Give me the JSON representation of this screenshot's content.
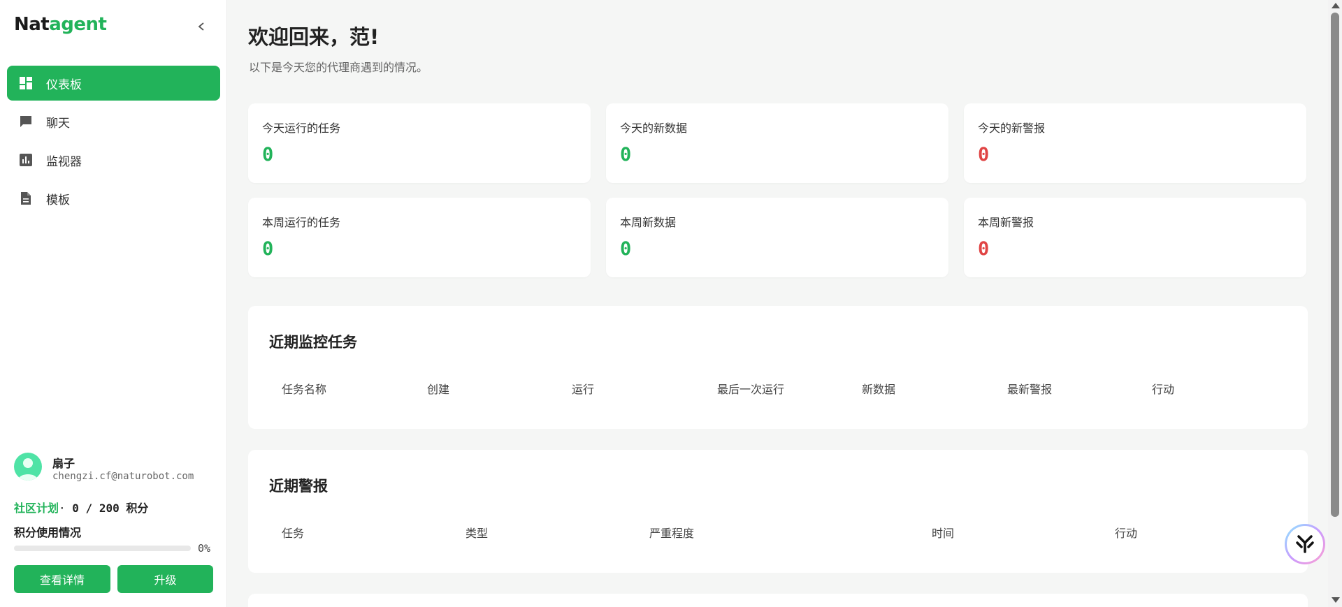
{
  "brand": {
    "part1": "Nat",
    "part2": "agent"
  },
  "sidebar": {
    "items": [
      {
        "label": "仪表板",
        "icon": "dashboard-icon",
        "active": true
      },
      {
        "label": "聊天",
        "icon": "chat-icon",
        "active": false
      },
      {
        "label": "监视器",
        "icon": "bar-chart-icon",
        "active": false
      },
      {
        "label": "模板",
        "icon": "document-icon",
        "active": false
      }
    ]
  },
  "user": {
    "name": "扇子",
    "email": "chengzi.cf@naturobot.com",
    "plan_name": "社区计划",
    "plan_separator": "· ",
    "points": "0 / 200 积分",
    "usage_label": "积分使用情况",
    "usage_percent_text": "0%",
    "usage_fraction": 0,
    "details_button": "查看详情",
    "upgrade_button": "升级"
  },
  "main": {
    "welcome": "欢迎回来，范!",
    "subtitle": "以下是今天您的代理商遇到的情况。",
    "stats": [
      {
        "label": "今天运行的任务",
        "value": "0",
        "color": "#22b35a"
      },
      {
        "label": "今天的新数据",
        "value": "0",
        "color": "#22b35a"
      },
      {
        "label": "今天的新警报",
        "value": "0",
        "color": "#e04545"
      },
      {
        "label": "本周运行的任务",
        "value": "0",
        "color": "#22b35a"
      },
      {
        "label": "本周新数据",
        "value": "0",
        "color": "#22b35a"
      },
      {
        "label": "本周新警报",
        "value": "0",
        "color": "#e04545"
      }
    ],
    "recent_tasks": {
      "title": "近期监控任务",
      "columns": [
        "任务名称",
        "创建",
        "运行",
        "最后一次运行",
        "新数据",
        "最新警报",
        "行动"
      ]
    },
    "recent_alerts": {
      "title": "近期警报",
      "columns": [
        "任务",
        "类型",
        "严重程度",
        "时间",
        "行动"
      ]
    }
  },
  "colors": {
    "accent": "#22b35a",
    "alert": "#e04545"
  }
}
